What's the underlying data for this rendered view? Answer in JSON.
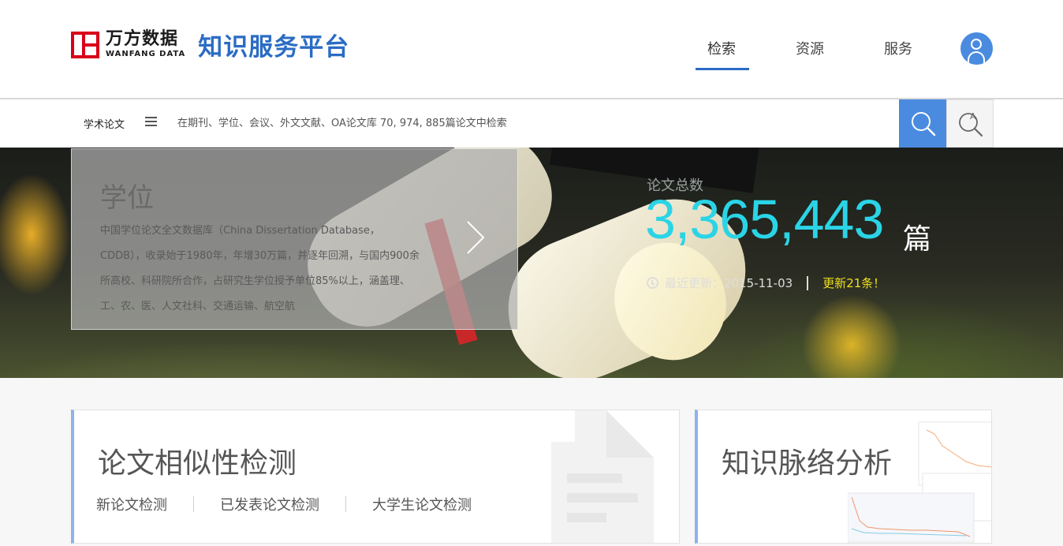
{
  "header": {
    "logo_cn": "万方数据",
    "logo_en": "WANFANG DATA",
    "platform_title": "知识服务平台",
    "nav": [
      {
        "label": "检索",
        "active": true
      },
      {
        "label": "资源",
        "active": false
      },
      {
        "label": "服务",
        "active": false
      }
    ],
    "avatar_icon": "user-icon",
    "accent_color": "#2b6cc4"
  },
  "search": {
    "category": "学术论文",
    "menu_icon": "menu-icon",
    "placeholder": "在期刊、学位、会议、外文文献、OA论文库 70, 974, 885篇论文中检索",
    "search_icon": "search-icon",
    "advanced_icon": "advanced-search-icon"
  },
  "banner": {
    "card_title": "学位",
    "card_desc": "中国学位论文全文数据库（China Dissertation Database，CDDB），收录始于1980年，年增30万篇，并逐年回溯，与国内900余所高校、科研院所合作，占研究生学位授予单位85%以上，涵盖理、工、农、医、人文社科、交通运输、航空航",
    "next_icon": "chevron-right-icon",
    "stat_label": "论文总数",
    "stat_number": "3,365,443",
    "stat_unit": "篇",
    "update_label": "最近更新：2015-11-03",
    "update_new": "更新21条！",
    "stat_color": "#2ad4e6",
    "update_color": "#f0e01c"
  },
  "tools": [
    {
      "title": "论文相似性检测",
      "links": [
        "新论文检测",
        "已发表论文检测",
        "大学生论文检测"
      ]
    },
    {
      "title": "知识脉络分析",
      "links": []
    }
  ]
}
